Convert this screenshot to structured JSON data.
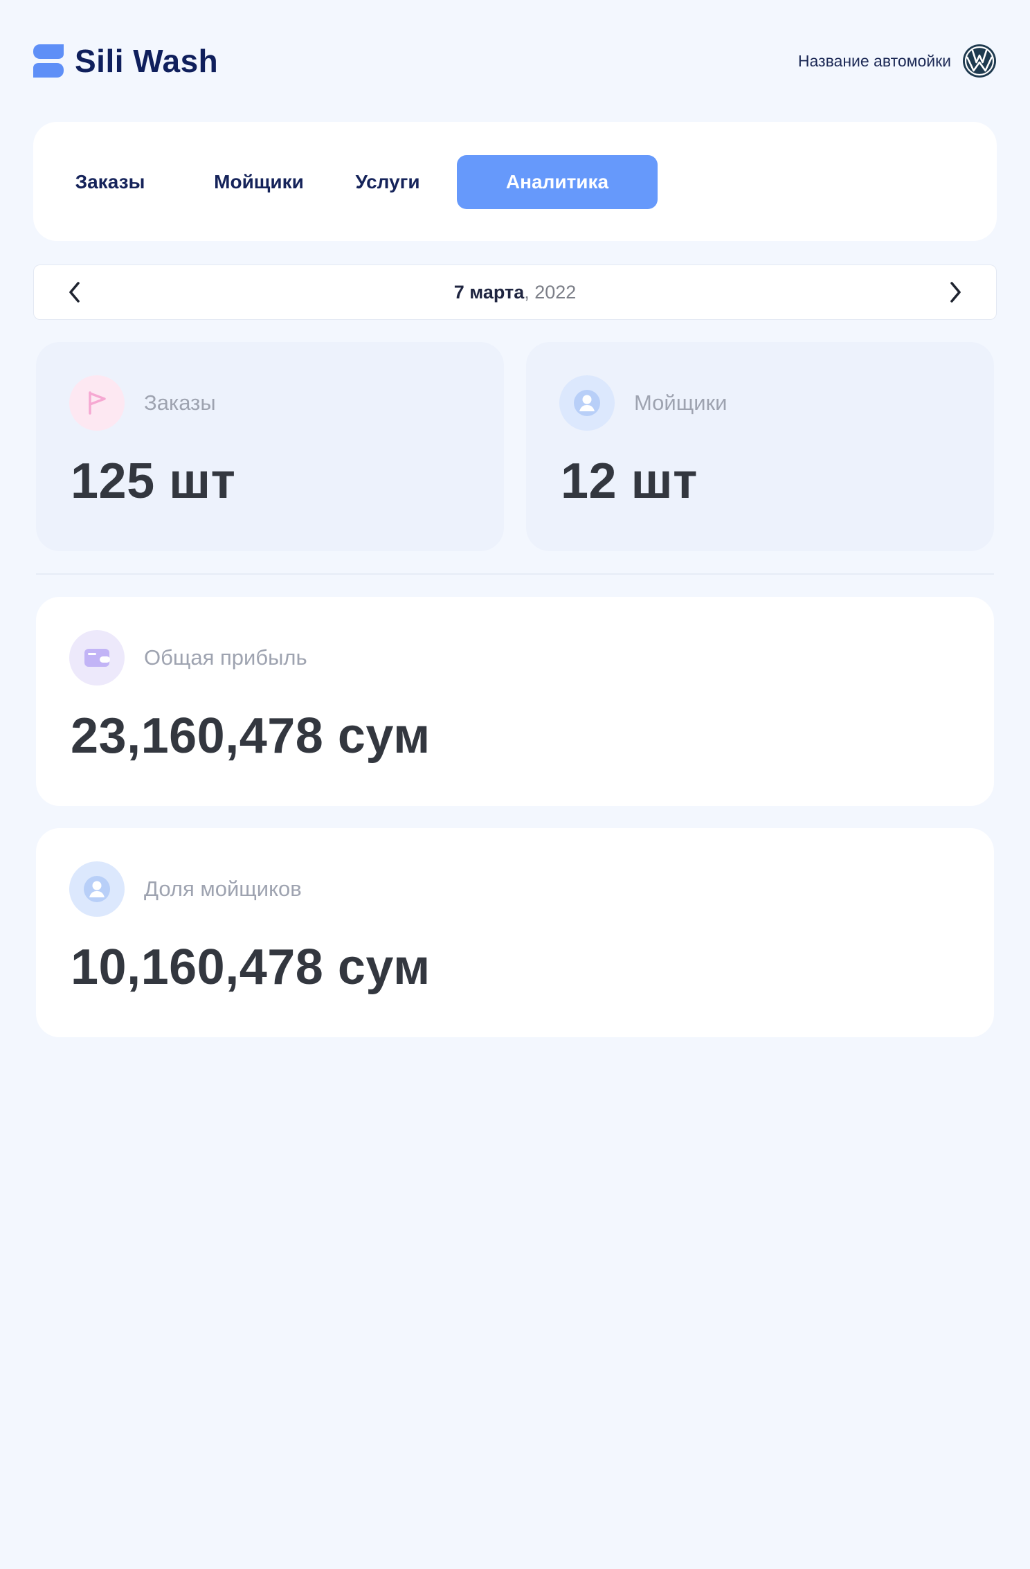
{
  "brand": {
    "name": "Sili Wash"
  },
  "carwash": {
    "name": "Название автомойки",
    "logo_icon": "volkswagen-logo-icon"
  },
  "tabs": [
    {
      "label": "Заказы",
      "active": false
    },
    {
      "label": "Мойщики",
      "active": false
    },
    {
      "label": "Услуги",
      "active": false
    },
    {
      "label": "Аналитика",
      "active": true
    }
  ],
  "date": {
    "day_month": "7 марта",
    "separator": ",",
    "year": " 2022"
  },
  "stats": {
    "orders": {
      "label": "Заказы",
      "value": "125 шт",
      "icon": "flag-icon"
    },
    "washers": {
      "label": "Мойщики",
      "value": "12 шт",
      "icon": "user-icon"
    },
    "profit": {
      "label": "Общая прибыль",
      "value": "23,160,478 сум",
      "icon": "wallet-icon"
    },
    "share": {
      "label": "Доля мойщиков",
      "value": "10,160,478 сум",
      "icon": "user-icon"
    }
  },
  "colors": {
    "accent": "#6699fb",
    "background": "#f3f7fe",
    "brand_text": "#0f1f5c",
    "orders_icon_bg": "#fde8f2",
    "washers_icon_bg": "#dce8fd",
    "profit_icon_bg": "#ede9fb"
  }
}
